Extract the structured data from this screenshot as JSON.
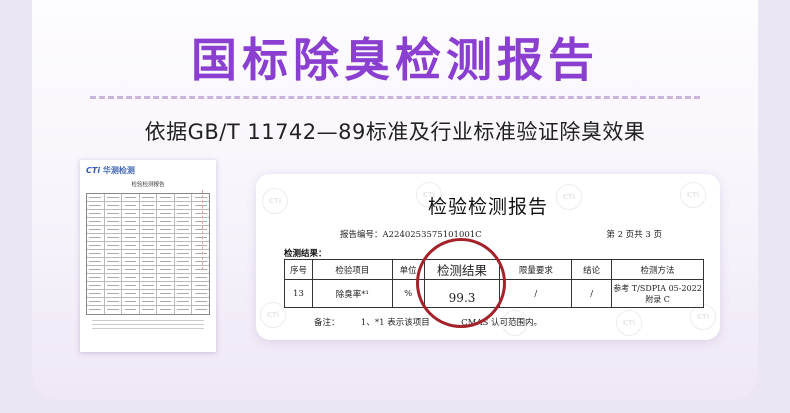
{
  "header": {
    "title": "国标除臭检测报告",
    "subtitle": "依据GB/T 11742—89标准及行业标准验证除臭效果"
  },
  "thumbnail": {
    "logo_mark": "CTi",
    "logo_text": "华测检测",
    "title": "检验检测报告"
  },
  "report": {
    "title": "检验检测报告",
    "report_no": "报告编号：A2240253575101001C",
    "page_no": "第 2 页共 3 页",
    "results_label": "检测结果：",
    "columns": [
      "序号",
      "检验项目",
      "单位",
      "检测结果",
      "限量要求",
      "结论",
      "检测方法"
    ],
    "row": {
      "no": "13",
      "item": "除臭率*¹",
      "unit": "%",
      "result": "99.3",
      "limit": "/",
      "conclusion": "/",
      "method_line1": "参考 T/SDPIA 05-2022",
      "method_line2": "附录 C"
    },
    "remark_label": "备注：",
    "remark_text_a": "1、*1 表示该项目",
    "remark_text_b": "CMAS 认可范围内。",
    "watermark": "CTi"
  },
  "colors": {
    "title_purple": "#8a3fd0",
    "stamp_red": "#a4232b",
    "background": "#ece6f3"
  }
}
